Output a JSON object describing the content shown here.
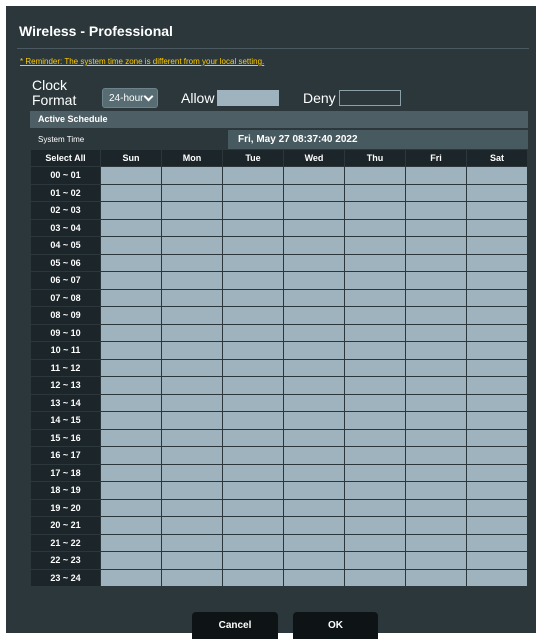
{
  "window": {
    "title": "Wireless - Professional"
  },
  "reminder": "* Reminder: The system time zone is different from your local setting.",
  "clock_format": {
    "label": "Clock Format",
    "selected": "24-hour",
    "chevron_icon": "chevron-down-icon"
  },
  "legend": {
    "allow_label": "Allow",
    "deny_label": "Deny",
    "allow_color": "#9eb3bd",
    "deny_color": "#2b373b"
  },
  "schedule": {
    "header": "Active Schedule",
    "system_time_label": "System Time",
    "system_time_value": "Fri, May 27 08:37:40 2022",
    "select_all_label": "Select All",
    "days": [
      "Sun",
      "Mon",
      "Tue",
      "Wed",
      "Thu",
      "Fri",
      "Sat"
    ],
    "time_slots": [
      "00 ~ 01",
      "01 ~ 02",
      "02 ~ 03",
      "03 ~ 04",
      "04 ~ 05",
      "05 ~ 06",
      "06 ~ 07",
      "07 ~ 08",
      "08 ~ 09",
      "09 ~ 10",
      "10 ~ 11",
      "11 ~ 12",
      "12 ~ 13",
      "13 ~ 14",
      "14 ~ 15",
      "15 ~ 16",
      "16 ~ 17",
      "17 ~ 18",
      "18 ~ 19",
      "19 ~ 20",
      "20 ~ 21",
      "21 ~ 22",
      "22 ~ 23",
      "23 ~ 24"
    ],
    "all_slots_state": "allow"
  },
  "buttons": {
    "cancel": "Cancel",
    "ok": "OK"
  }
}
